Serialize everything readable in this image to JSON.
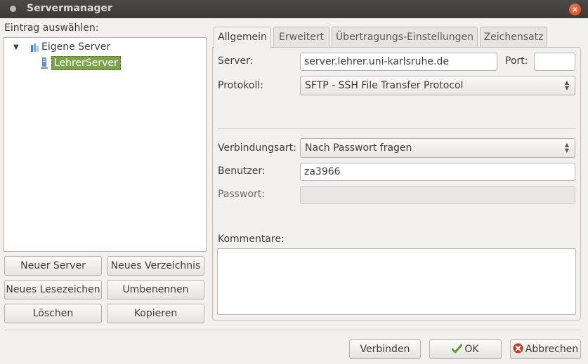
{
  "window": {
    "title": "Servermanager",
    "close_glyph": "×"
  },
  "left": {
    "heading": "Eintrag auswählen:",
    "tree": {
      "root": "Eigene Server",
      "child": "LehrerServer",
      "expand_glyph": "▼"
    },
    "buttons": {
      "new_server": "Neuer Server",
      "new_folder": "Neues Verzeichnis",
      "new_bookmark": "Neues Lesezeichen",
      "rename": "Umbenennen",
      "delete": "Löschen",
      "copy": "Kopieren"
    }
  },
  "tabs": [
    "Allgemein",
    "Erweitert",
    "Übertragungs-Einstellungen",
    "Zeichensatz"
  ],
  "general": {
    "server_label": "Server:",
    "server_value": "server.lehrer.uni-karlsruhe.de",
    "port_label": "Port:",
    "port_value": "",
    "protocol_label": "Protokoll:",
    "protocol_value": "SFTP - SSH File Transfer Protocol",
    "logon_label": "Verbindungsart:",
    "logon_value": "Nach Passwort fragen",
    "user_label": "Benutzer:",
    "user_value": "za3966",
    "password_label": "Passwort:",
    "password_value": "",
    "comments_label": "Kommentare:",
    "comments_value": "",
    "combo_glyph": "▲▼"
  },
  "footer": {
    "connect": "Verbinden",
    "ok": "OK",
    "cancel": "Abbrechen"
  },
  "icons": {
    "close": "close-icon",
    "folder": "server-folder-icon",
    "server": "server-icon",
    "ok": "checkmark-icon",
    "cancel": "cancel-icon"
  },
  "colors": {
    "selection": "#7ea24c",
    "titlebar": "#3c3b37",
    "close": "#df4a16"
  }
}
